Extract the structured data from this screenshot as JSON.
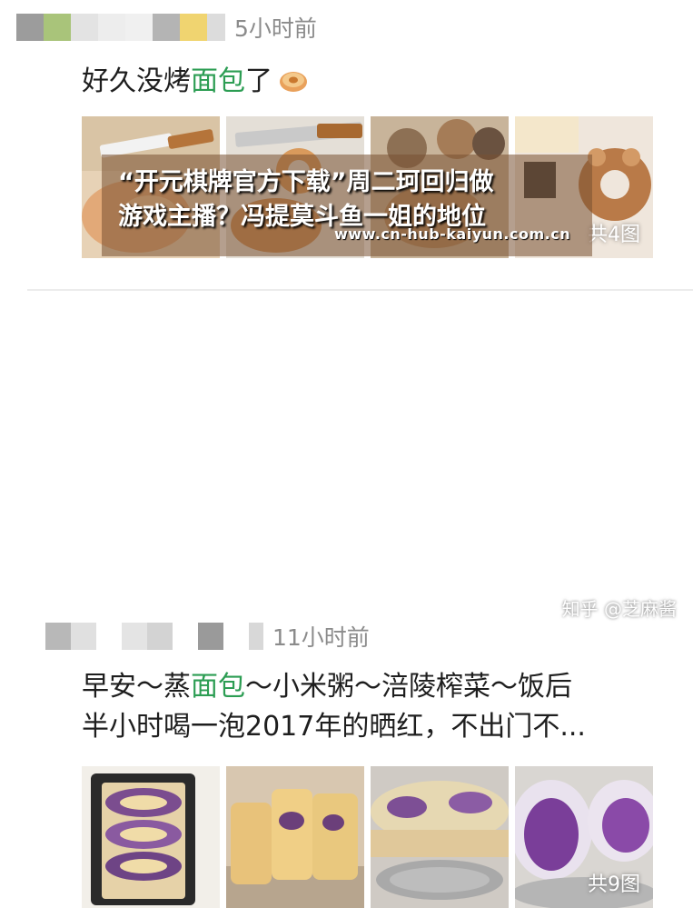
{
  "colors": {
    "highlight": "#2c9d53",
    "time": "#8b8b8b"
  },
  "post1": {
    "time": "5小时前",
    "text_before": "好久没烤",
    "text_highlight": "面包",
    "text_after": "了",
    "emoji": "bread-emoji",
    "image_count": "共4图"
  },
  "post2": {
    "time": "11小时前",
    "line1_before": "早安～蒸",
    "line1_highlight": "面包",
    "line1_after": "～小米粥～涪陵榨菜～饭后",
    "line2": "半小时喝一泡2017年的晒红，不出门不...",
    "image_count": "共9图"
  },
  "overlay": {
    "line1": "“开元棋牌官方下载”周二珂回归做",
    "line2": "游戏主播？冯提莫斗鱼一姐的地位",
    "url": "www.cn-hub-kaiyun.com.cn"
  },
  "watermark": "知乎 @芝麻酱"
}
